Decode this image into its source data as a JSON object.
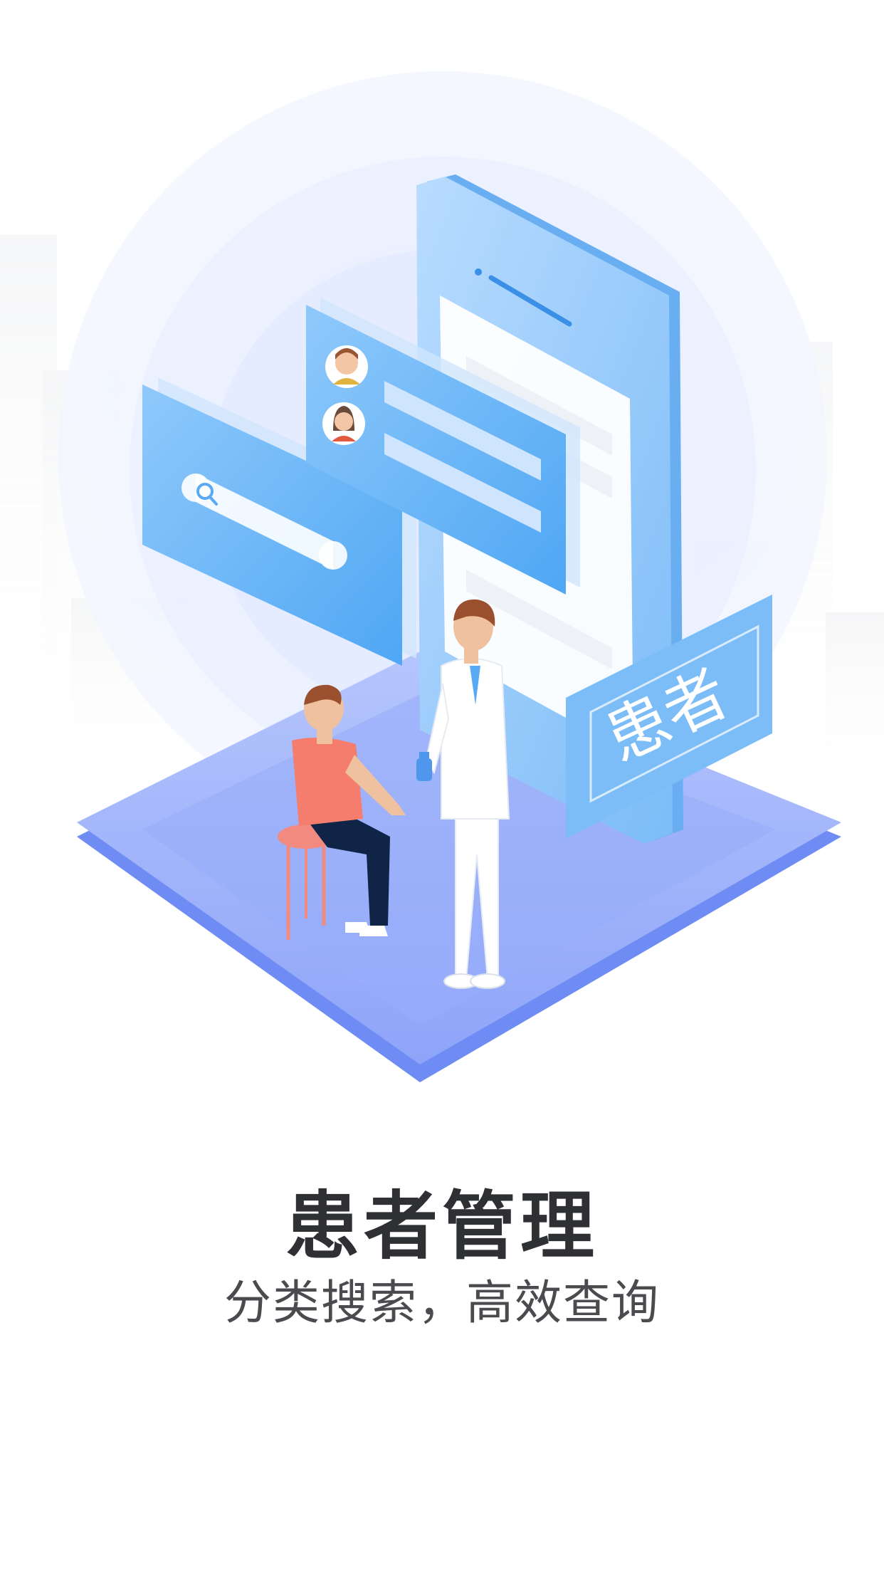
{
  "onboarding": {
    "title": "患者管理",
    "subtitle": "分类搜索，高效查询",
    "illustration": {
      "sign_label": "患者",
      "icons": [
        "search-icon",
        "patient-avatar-male",
        "patient-avatar-female",
        "doctor-figure",
        "patient-figure"
      ]
    }
  },
  "colors": {
    "primary_blue": "#5aa9f5",
    "platform": "#9db1fb",
    "platform_edge": "#6f8cf5",
    "text_dark": "#2f3033",
    "text_sub": "#4a4b4e"
  }
}
